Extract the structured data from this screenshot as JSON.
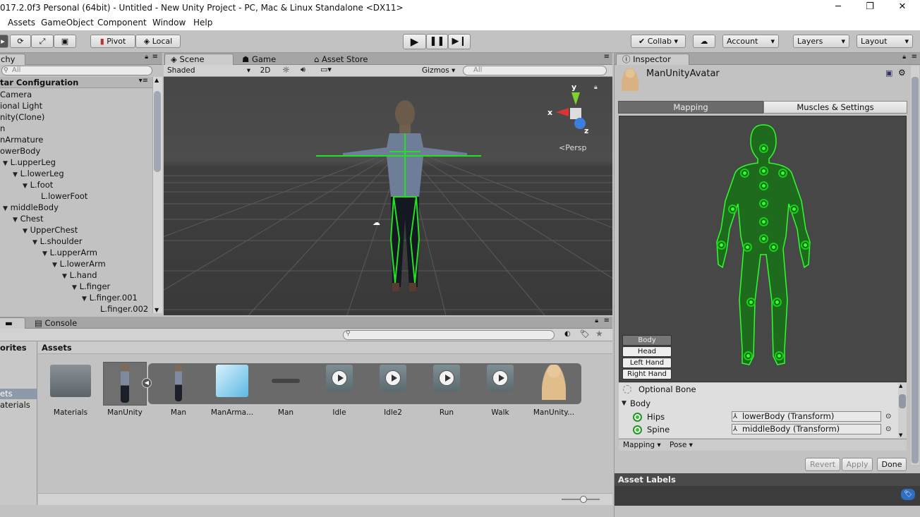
{
  "window": {
    "title": "017.2.0f3 Personal (64bit) - Untitled - New Unity Project - PC, Mac & Linux Standalone <DX11>",
    "min": "─",
    "max": "❐",
    "close": "✕"
  },
  "menu": [
    "Assets",
    "GameObject",
    "Component",
    "Window",
    "Help"
  ],
  "toolbar": {
    "pivot": "Pivot",
    "local": "Local",
    "collab": "Collab",
    "account": "Account",
    "layers": "Layers",
    "layout": "Layout"
  },
  "hierarchy": {
    "tab": "chy",
    "search_placeholder": "All",
    "root": "tar Configuration",
    "items": [
      {
        "label": "Camera",
        "indent": 0,
        "arrow": ""
      },
      {
        "label": "ional Light",
        "indent": 0,
        "arrow": ""
      },
      {
        "label": "nity(Clone)",
        "indent": 0,
        "arrow": ""
      },
      {
        "label": "n",
        "indent": 0,
        "arrow": ""
      },
      {
        "label": "nArmature",
        "indent": 0,
        "arrow": ""
      },
      {
        "label": "owerBody",
        "indent": 0,
        "arrow": ""
      },
      {
        "label": "L.upperLeg",
        "indent": 0,
        "arrow": "▼"
      },
      {
        "label": "L.lowerLeg",
        "indent": 1,
        "arrow": "▼"
      },
      {
        "label": "L.foot",
        "indent": 2,
        "arrow": "▼"
      },
      {
        "label": "L.lowerFoot",
        "indent": 3,
        "arrow": ""
      },
      {
        "label": "middleBody",
        "indent": 0,
        "arrow": "▼"
      },
      {
        "label": "Chest",
        "indent": 1,
        "arrow": "▼"
      },
      {
        "label": "UpperChest",
        "indent": 2,
        "arrow": "▼"
      },
      {
        "label": "L.shoulder",
        "indent": 3,
        "arrow": "▼"
      },
      {
        "label": "L.upperArm",
        "indent": 4,
        "arrow": "▼"
      },
      {
        "label": "L.lowerArm",
        "indent": 5,
        "arrow": "▼"
      },
      {
        "label": "L.hand",
        "indent": 6,
        "arrow": "▼"
      },
      {
        "label": "L.finger",
        "indent": 7,
        "arrow": "▼"
      },
      {
        "label": "L.finger.001",
        "indent": 8,
        "arrow": "▼"
      },
      {
        "label": "L.finger.002",
        "indent": 9,
        "arrow": ""
      }
    ]
  },
  "scene": {
    "tabs": [
      "Scene",
      "Game",
      "Asset Store"
    ],
    "shading": "Shaded",
    "mode2d": "2D",
    "gizmos": "Gizmos",
    "search_placeholder": "All",
    "persp": "Persp",
    "axes": {
      "x": "x",
      "y": "y",
      "z": "z"
    }
  },
  "project": {
    "tab_console": "Console",
    "favorites_header": "orites",
    "fav_items": [
      "ets",
      "aterials"
    ],
    "assets_header": "Assets",
    "assets": [
      "Materials",
      "ManUnity",
      "Man",
      "ManArma...",
      "Man",
      "Idle",
      "Idle2",
      "Run",
      "Walk",
      "ManUnity..."
    ]
  },
  "inspector": {
    "tab": "Inspector",
    "object_name": "ManUnityAvatar",
    "tab_mapping": "Mapping",
    "tab_muscles": "Muscles & Settings",
    "body_buttons": [
      "Body",
      "Head",
      "Left Hand",
      "Right Hand"
    ],
    "optional_bone": "Optional Bone",
    "body_group": "Body",
    "bones": [
      {
        "name": "Hips",
        "value": "lowerBody (Transform)"
      },
      {
        "name": "Spine",
        "value": "middleBody (Transform)"
      }
    ],
    "bottom_mapping": "Mapping",
    "bottom_pose": "Pose",
    "revert": "Revert",
    "apply": "Apply",
    "done": "Done",
    "asset_labels": "Asset Labels"
  }
}
